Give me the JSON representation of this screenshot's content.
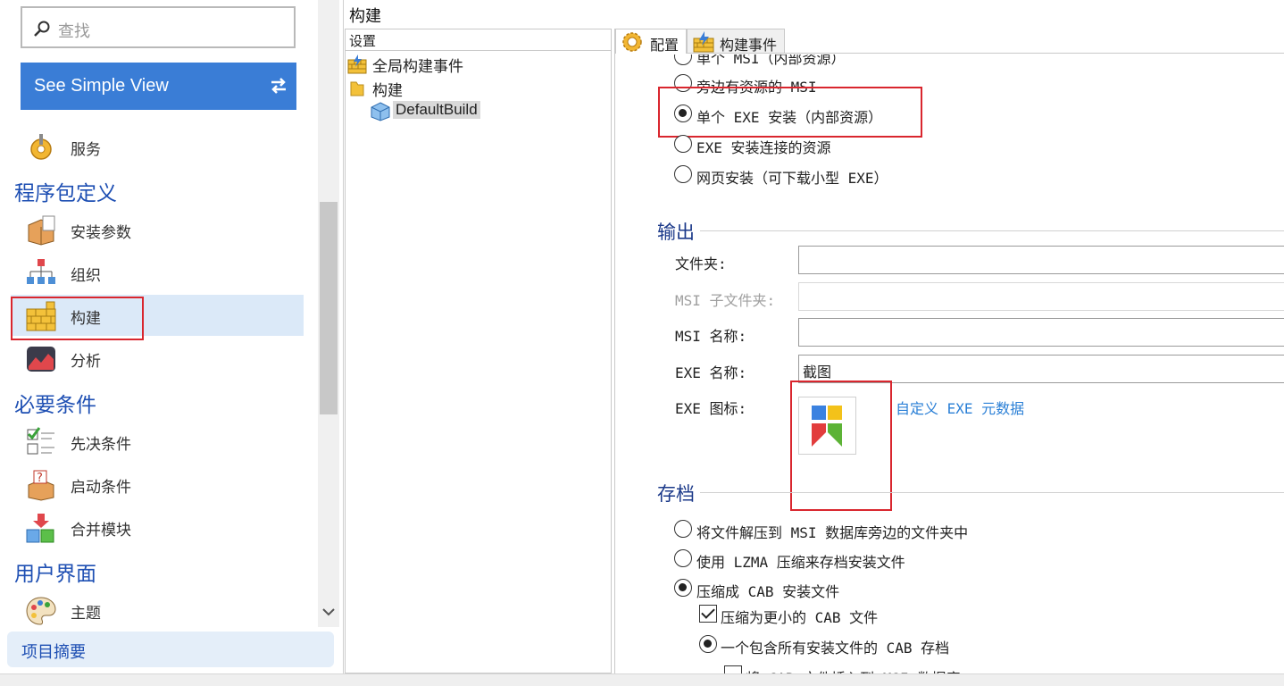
{
  "search": {
    "placeholder": "查找"
  },
  "simple_view": {
    "label": "See Simple View"
  },
  "nav": {
    "services": "服务",
    "group_package": "程序包定义",
    "install_params": "安装参数",
    "organization": "组织",
    "build": "构建",
    "analysis": "分析",
    "group_prereq": "必要条件",
    "prerequisites": "先决条件",
    "launch_conditions": "启动条件",
    "merge_modules": "合并模块",
    "group_ui": "用户界面",
    "theme": "主题",
    "project_summary": "项目摘要"
  },
  "page_title": "构建",
  "tree": {
    "header": "设置",
    "items": [
      "全局构建事件",
      "构建",
      "DefaultBuild"
    ]
  },
  "tabs": [
    "配置",
    "构建事件"
  ],
  "package_type": {
    "options": [
      {
        "label": "单个 MSI（内部资源）",
        "selected": false
      },
      {
        "label": "旁边有资源的 MSI",
        "selected": false
      },
      {
        "label": "单个 EXE 安装（内部资源）",
        "selected": true
      },
      {
        "label": "EXE 安装连接的资源",
        "selected": false
      },
      {
        "label": "网页安装（可下载小型 EXE）",
        "selected": false
      }
    ]
  },
  "output": {
    "title": "输出",
    "folder_label": "文件夹:",
    "folder_value": "",
    "msi_subfolder_label": "MSI 子文件夹:",
    "msi_subfolder_value": "",
    "msi_name_label": "MSI 名称:",
    "msi_name_value": "",
    "exe_name_label": "EXE 名称:",
    "exe_name_value": "截图",
    "exe_icon_label": "EXE 图标:",
    "custom_metadata_link": "自定义 EXE 元数据"
  },
  "archive": {
    "title": "存档",
    "options": [
      {
        "label": "将文件解压到 MSI 数据库旁边的文件夹中",
        "selected": false
      },
      {
        "label": "使用 LZMA 压缩来存档安装文件",
        "selected": false
      },
      {
        "label": "压缩成 CAB 安装文件",
        "selected": true
      }
    ],
    "smaller_cab_label": "压缩为更小的 CAB 文件",
    "smaller_cab_checked": true,
    "single_cab_label": "一个包含所有安装文件的 CAB 存档",
    "single_cab_selected": true,
    "embed_cab_label": "将 CAB 文件插入到 MSI 数据库"
  },
  "colors": {
    "accent": "#3a7dd6",
    "group_heading": "#1e4fb3",
    "highlight_box": "#d9262e",
    "link": "#2a7fd6",
    "active_item_bg": "#dbe9f8"
  }
}
